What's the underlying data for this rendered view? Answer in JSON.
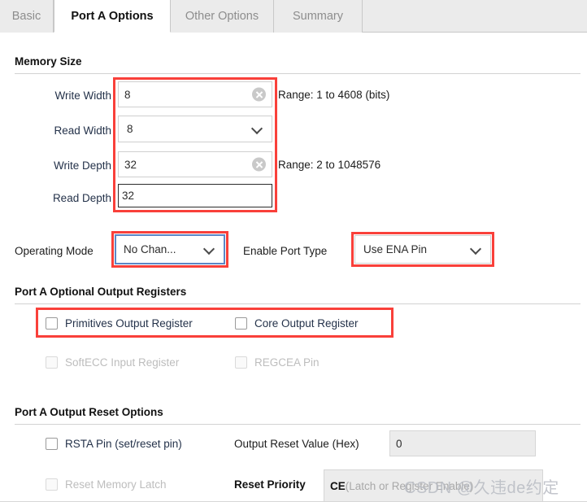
{
  "tabs": [
    {
      "label": "Basic",
      "active": false
    },
    {
      "label": "Port A Options",
      "active": true
    },
    {
      "label": "Other Options",
      "active": false
    },
    {
      "label": "Summary",
      "active": false
    }
  ],
  "sections": {
    "memory_size": {
      "title": "Memory Size",
      "rows": [
        {
          "label": "Write Width",
          "value": "8",
          "kind": "text",
          "hint": "Range: 1 to 4608 (bits)",
          "clear": true,
          "focused": false
        },
        {
          "label": "Read Width",
          "value": "8",
          "kind": "select",
          "hint": "",
          "clear": false,
          "focused": false
        },
        {
          "label": "Write Depth",
          "value": "32",
          "kind": "text",
          "hint": "Range: 2 to 1048576",
          "clear": true,
          "focused": false
        },
        {
          "label": "Read Depth",
          "value": "32",
          "kind": "text",
          "hint": "",
          "clear": false,
          "focused": true
        }
      ]
    },
    "mode_row": {
      "operating_mode_label": "Operating Mode",
      "operating_mode_value": "No Chan...",
      "enable_port_type_label": "Enable Port Type",
      "enable_port_type_value": "Use ENA Pin"
    },
    "optional_output_registers": {
      "title": "Port A Optional Output Registers",
      "checkboxes": [
        {
          "label": "Primitives Output Register",
          "checked": false,
          "disabled": false
        },
        {
          "label": "Core Output Register",
          "checked": false,
          "disabled": false
        },
        {
          "label": "SoftECC Input Register",
          "checked": false,
          "disabled": true
        },
        {
          "label": "REGCEA Pin",
          "checked": false,
          "disabled": true
        }
      ]
    },
    "output_reset_options": {
      "title": "Port A Output Reset Options",
      "rsta_checkbox": {
        "label": "RSTA Pin (set/reset pin)",
        "checked": false,
        "disabled": false
      },
      "reset_memory_latch_checkbox": {
        "label": "Reset Memory Latch",
        "checked": false,
        "disabled": true
      },
      "output_reset_value_label": "Output Reset Value (Hex)",
      "output_reset_value": "0",
      "reset_priority_label": "Reset Priority",
      "reset_priority_value_strong": "CE",
      "reset_priority_value_rest": " (Latch or Register Enable)"
    }
  },
  "watermark": {
    "text": "CSDN @久违de约定"
  },
  "colors": {
    "annotation_red": "#f9403a",
    "focus_blue": "#5b87c7",
    "tab_inactive_bg": "#ebebeb",
    "label_blue_gray": "#24324a",
    "disabled_gray": "#bdbdbd"
  }
}
